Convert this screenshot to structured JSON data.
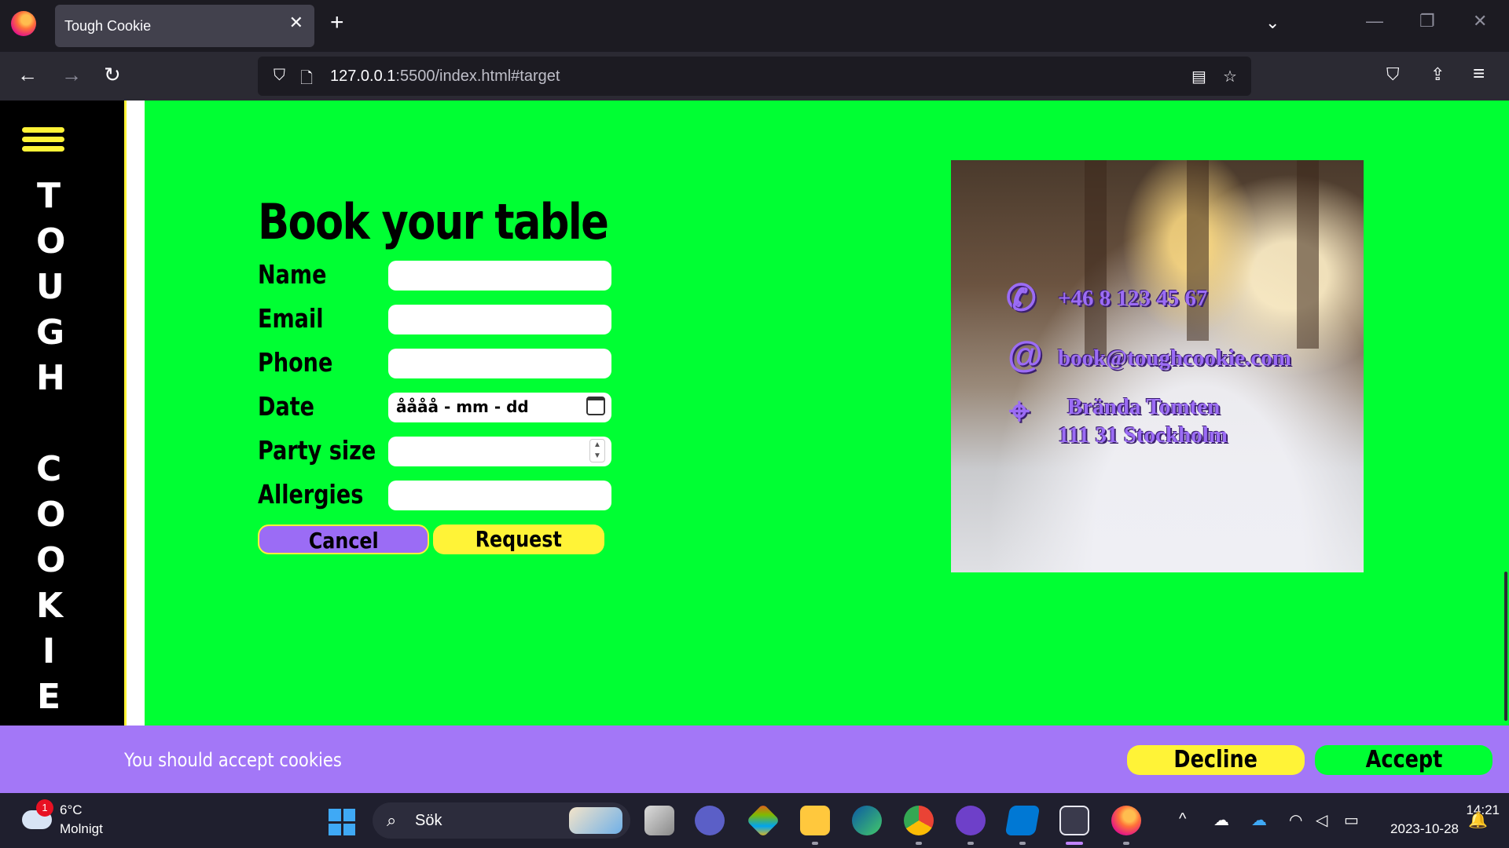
{
  "browser": {
    "tab_title": "Tough Cookie",
    "tab_close": "✕",
    "new_tab": "+",
    "tab_list": "⌄",
    "minimize": "—",
    "restore": "❐",
    "close": "✕",
    "back": "←",
    "forward": "→",
    "reload": "↻",
    "url_host": "127.0.0.1",
    "url_rest": ":5500/index.html#target",
    "shield": "⛉",
    "page_icon": "🗋",
    "reader": "▤",
    "bookmark": "☆",
    "pocket": "⛉",
    "extensions": "⇪",
    "menu": "≡"
  },
  "sidebar": {
    "brand_top": [
      "T",
      "O",
      "U",
      "G",
      "H"
    ],
    "brand_bottom": [
      "C",
      "O",
      "O",
      "K",
      "I",
      "E"
    ]
  },
  "booking": {
    "title": "Book your table",
    "fields": {
      "name": "Name",
      "email": "Email",
      "phone": "Phone",
      "date": "Date",
      "party": "Party size",
      "allergies": "Allergies"
    },
    "date_placeholder": "åååå - mm - dd",
    "cancel": "Cancel",
    "request": "Request"
  },
  "contact": {
    "phone": "+46 8 123 45 67",
    "email": "book@toughcookie.com",
    "address_line1": "Brända Tomten",
    "address_line2": "111 31 Stockholm",
    "phone_icon": "✆",
    "email_icon": "@",
    "location_icon": "⌖"
  },
  "cookie_banner": {
    "text": "You should accept cookies",
    "decline": "Decline",
    "accept": "Accept"
  },
  "taskbar": {
    "weather_badge": "1",
    "temperature": "6°C",
    "weather": "Molnigt",
    "search_glyph": "⌕",
    "search_label": "Sök",
    "tray_chevron": "^",
    "time": "14:21",
    "date": "2023-10-28"
  },
  "colors": {
    "page_bg": "#00ff33",
    "accent_purple": "#9b6cf5",
    "accent_yellow": "#fff337"
  }
}
